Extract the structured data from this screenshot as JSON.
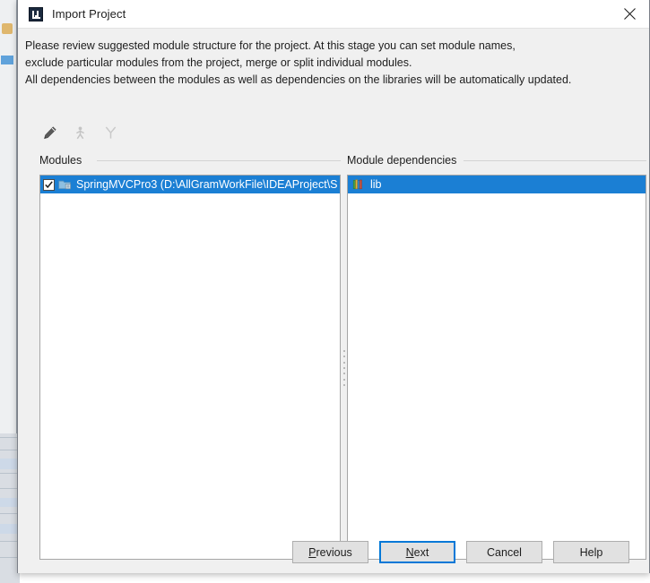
{
  "window": {
    "title": "Import Project",
    "app_icon": "intellij-idea-icon",
    "close_icon": "close-icon"
  },
  "description": {
    "line1": "Please review suggested module structure for the project. At this stage you can set module names,",
    "line2": "exclude particular modules from the project, merge or split individual modules.",
    "line3": "All dependencies between the modules as well as dependencies on the libraries will be automatically updated."
  },
  "toolbar": {
    "items": [
      {
        "name": "edit-pencil-icon",
        "label": "Edit",
        "enabled": true
      },
      {
        "name": "merge-modules-icon",
        "label": "Merge",
        "enabled": false
      },
      {
        "name": "split-module-icon",
        "label": "Split",
        "enabled": false
      }
    ]
  },
  "panels": {
    "modules": {
      "label": "Modules",
      "rows": [
        {
          "checked": true,
          "icon": "module-folder-icon",
          "label": "SpringMVCPro3 (D:\\AllGramWorkFile\\IDEAProject\\S",
          "selected": true
        }
      ]
    },
    "dependencies": {
      "label": "Module dependencies",
      "rows": [
        {
          "icon": "library-icon",
          "label": "lib",
          "selected": true
        }
      ]
    }
  },
  "buttons": [
    {
      "name": "previous-button",
      "label": "Previous",
      "accel": "P",
      "focused": false
    },
    {
      "name": "next-button",
      "label": "Next",
      "accel": "N",
      "focused": true
    },
    {
      "name": "cancel-button",
      "label": "Cancel",
      "accel": "",
      "focused": false
    },
    {
      "name": "help-button",
      "label": "Help",
      "accel": "",
      "focused": false
    }
  ],
  "colors": {
    "selection_blue": "#1b7fd4",
    "focus_blue": "#0078d7",
    "dialog_bg": "#f0f0f0",
    "panel_bg": "#ffffff",
    "text": "#1d1d1d"
  }
}
